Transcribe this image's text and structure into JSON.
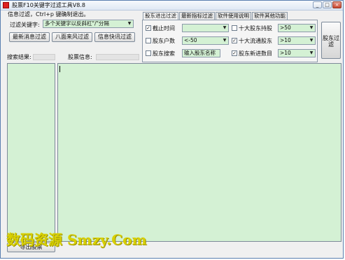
{
  "window": {
    "title": "股票F10关键字过滤工具V8.8",
    "minimize": "_",
    "maximize": "□",
    "close": "×"
  },
  "menu": {
    "text": "信息过滤，Ctrl+p 键确制退出。"
  },
  "filter": {
    "keyword_label": "过滤关键字:",
    "keyword_value": "多个关键字以反斜杠\"/\"分隔",
    "buttons": [
      "最新消息过滤",
      "八面来风过滤",
      "信息快讯过滤"
    ]
  },
  "labels": {
    "search_results": "搜索结果:",
    "stock_info": "股票信息:"
  },
  "tabs": [
    "股东进出过滤",
    "最新指标过滤",
    "软件使用说明",
    "软件其他功能"
  ],
  "options": {
    "cutoff_time": {
      "label": "截止时间",
      "checked": true,
      "value": ""
    },
    "holder_count": {
      "label": "股东户数",
      "checked": false,
      "value": "<-50"
    },
    "holder_search": {
      "label": "股东搜索",
      "checked": false,
      "value": "输入股东名称"
    },
    "top10_holders": {
      "label": "十大股东持股",
      "checked": false,
      "value": ">50"
    },
    "top10_float": {
      "label": "十大流通股东",
      "checked": true,
      "value": ">10"
    },
    "new_holders": {
      "label": "股东新进数目",
      "checked": true,
      "value": ">10"
    }
  },
  "filter_button": "股东过滤",
  "export_button": "导出股票",
  "watermark": "数码资源  Smzy.Com",
  "colors": {
    "field_bg": "#d4f1d4",
    "window_bg": "#f0f0f0"
  }
}
